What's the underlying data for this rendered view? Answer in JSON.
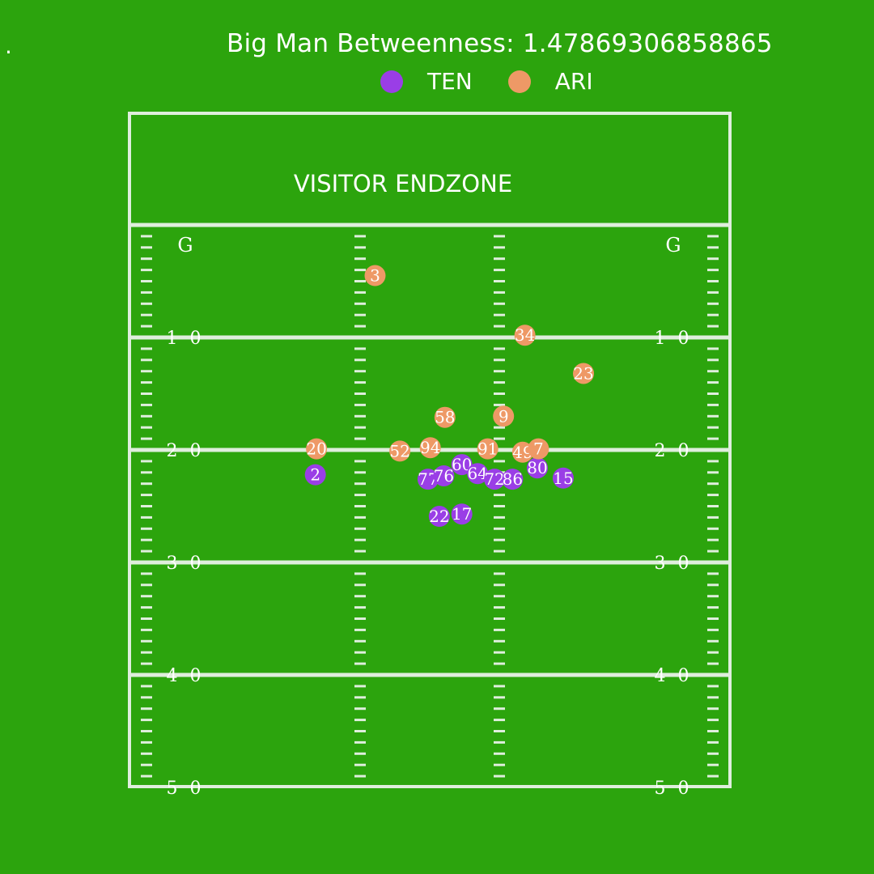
{
  "header": {
    "dot": ".",
    "title": "Big Man Betweenness: 1.47869306858865"
  },
  "legend": [
    {
      "team": "TEN",
      "color": "#9a3ee6"
    },
    {
      "team": "ARI",
      "color": "#ee9966"
    }
  ],
  "field": {
    "endzone_label": "VISITOR ENDZONE",
    "goal_label": "G",
    "yard_numbers": [
      "1 0",
      "2 0",
      "3 0",
      "4 0",
      "5 0"
    ],
    "line_color": "#dfeedd"
  },
  "chart_data": {
    "type": "scatter",
    "title": "Big Man Betweenness: 1.47869306858865",
    "xlabel": "",
    "ylabel": "",
    "xlim": [
      0,
      53.3
    ],
    "ylim": [
      -10,
      50
    ],
    "legend_position": "top",
    "grid": false,
    "series": [
      {
        "name": "TEN",
        "color": "#9a3ee6",
        "points": [
          {
            "label": "2",
            "x": 16.5,
            "y": 22.2
          },
          {
            "label": "77",
            "x": 26.5,
            "y": 22.6
          },
          {
            "label": "76",
            "x": 27.9,
            "y": 22.3
          },
          {
            "label": "60",
            "x": 29.5,
            "y": 21.3
          },
          {
            "label": "64",
            "x": 30.9,
            "y": 22.1
          },
          {
            "label": "72",
            "x": 32.4,
            "y": 22.6
          },
          {
            "label": "86",
            "x": 34.0,
            "y": 22.6
          },
          {
            "label": "80",
            "x": 36.2,
            "y": 21.6
          },
          {
            "label": "15",
            "x": 38.5,
            "y": 22.5
          },
          {
            "label": "22",
            "x": 27.5,
            "y": 25.9
          },
          {
            "label": "17",
            "x": 29.5,
            "y": 25.7
          }
        ]
      },
      {
        "name": "ARI",
        "color": "#ee9966",
        "points": [
          {
            "label": "3",
            "x": 21.8,
            "y": 4.5
          },
          {
            "label": "34",
            "x": 35.1,
            "y": 9.8
          },
          {
            "label": "23",
            "x": 40.3,
            "y": 13.2
          },
          {
            "label": "58",
            "x": 28.0,
            "y": 17.1
          },
          {
            "label": "9",
            "x": 33.2,
            "y": 17.0
          },
          {
            "label": "20",
            "x": 16.6,
            "y": 19.9
          },
          {
            "label": "52",
            "x": 24.0,
            "y": 20.1
          },
          {
            "label": "94",
            "x": 26.7,
            "y": 19.8
          },
          {
            "label": "91",
            "x": 31.8,
            "y": 19.9
          },
          {
            "label": "49",
            "x": 34.9,
            "y": 20.2
          },
          {
            "label": "7",
            "x": 36.3,
            "y": 19.9
          }
        ]
      }
    ]
  }
}
